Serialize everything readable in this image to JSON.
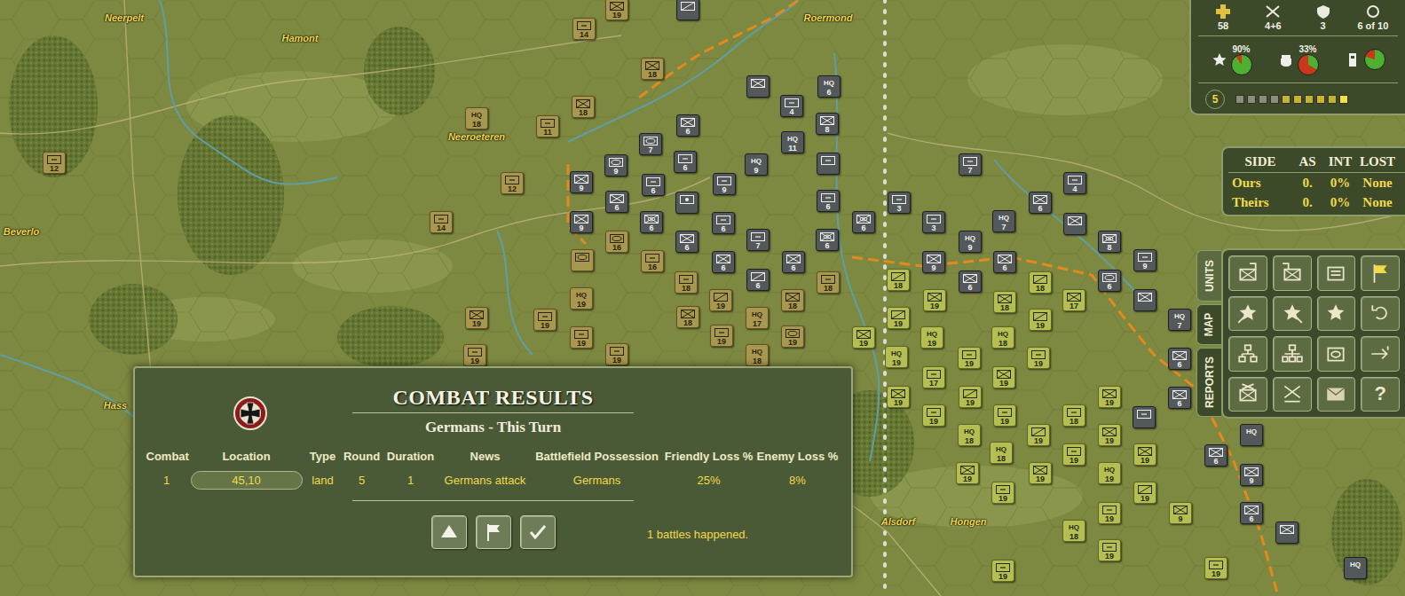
{
  "places": [
    {
      "name": "Neerpelt"
    },
    {
      "name": "Hamont"
    },
    {
      "name": "Neeroeteren"
    },
    {
      "name": "Beverlo"
    },
    {
      "name": "Hass"
    },
    {
      "name": "Alsdorf"
    },
    {
      "name": "Hongen"
    },
    {
      "name": "Roermond"
    }
  ],
  "counters": [
    {
      "side": "british",
      "symbol": "inf",
      "number": "19"
    },
    {
      "side": "german",
      "symbol": "recon"
    },
    {
      "side": "british",
      "symbol": "other",
      "number": "14"
    },
    {
      "side": "british",
      "symbol": "inf",
      "number": "18"
    },
    {
      "side": "british",
      "symbol": "inf",
      "number": "18"
    },
    {
      "side": "british",
      "symbol": "hq",
      "label": "HQ",
      "number": "18"
    },
    {
      "side": "british",
      "symbol": "other",
      "number": "11"
    },
    {
      "side": "british",
      "symbol": "other",
      "number": "12"
    },
    {
      "side": "british",
      "symbol": "other",
      "number": "12"
    },
    {
      "side": "british",
      "symbol": "other",
      "number": "14"
    },
    {
      "side": "british",
      "symbol": "inf",
      "number": "19"
    },
    {
      "side": "british",
      "symbol": "other",
      "number": "19"
    },
    {
      "side": "british",
      "symbol": "armor"
    },
    {
      "side": "british",
      "symbol": "hq",
      "label": "HQ",
      "number": "19"
    },
    {
      "side": "british",
      "symbol": "other",
      "number": "19"
    },
    {
      "side": "british",
      "symbol": "other",
      "number": "19"
    },
    {
      "side": "british",
      "symbol": "other",
      "number": "19"
    },
    {
      "side": "british",
      "symbol": "inf",
      "number": "18"
    },
    {
      "side": "british",
      "symbol": "other",
      "number": "18"
    },
    {
      "side": "british",
      "symbol": "recon",
      "number": "19"
    },
    {
      "side": "british",
      "symbol": "hq",
      "label": "HQ",
      "number": "17"
    },
    {
      "side": "british",
      "symbol": "other",
      "number": "19"
    },
    {
      "side": "british",
      "symbol": "hq",
      "label": "HQ",
      "number": "18"
    },
    {
      "side": "british",
      "symbol": "armor",
      "number": "19"
    },
    {
      "side": "british",
      "symbol": "inf",
      "number": "18"
    },
    {
      "side": "british",
      "symbol": "other",
      "number": "18"
    },
    {
      "side": "british",
      "symbol": "other",
      "number": "16"
    },
    {
      "side": "british",
      "symbol": "armor",
      "number": "16"
    },
    {
      "side": "german",
      "symbol": "inf"
    },
    {
      "side": "german",
      "symbol": "hq",
      "label": "HQ",
      "number": "6"
    },
    {
      "side": "german",
      "symbol": "other",
      "number": "4"
    },
    {
      "side": "german",
      "symbol": "inf",
      "number": "8"
    },
    {
      "side": "german",
      "symbol": "inf",
      "number": "6"
    },
    {
      "side": "german",
      "symbol": "armor",
      "number": "7"
    },
    {
      "side": "german",
      "symbol": "hq",
      "label": "HQ",
      "number": "11"
    },
    {
      "side": "german",
      "symbol": "other",
      "number": "6"
    },
    {
      "side": "german",
      "symbol": "hq",
      "label": "HQ",
      "number": "9"
    },
    {
      "side": "german",
      "symbol": "other"
    },
    {
      "side": "german",
      "symbol": "armor",
      "number": "9"
    },
    {
      "side": "german",
      "symbol": "inf",
      "number": "9"
    },
    {
      "side": "german",
      "symbol": "other",
      "number": "6"
    },
    {
      "side": "german",
      "symbol": "other",
      "number": "9"
    },
    {
      "side": "german",
      "symbol": "art"
    },
    {
      "side": "german",
      "symbol": "other",
      "number": "6"
    },
    {
      "side": "german",
      "symbol": "inf",
      "number": "6"
    },
    {
      "side": "german",
      "symbol": "inf",
      "number": "9"
    },
    {
      "side": "german",
      "symbol": "mech",
      "number": "6"
    },
    {
      "side": "german",
      "symbol": "inf",
      "number": "6"
    },
    {
      "side": "german",
      "symbol": "other",
      "number": "6"
    },
    {
      "side": "german",
      "symbol": "other",
      "number": "7"
    },
    {
      "side": "german",
      "symbol": "mech",
      "number": "6"
    },
    {
      "side": "german",
      "symbol": "inf",
      "number": "6"
    },
    {
      "side": "german",
      "symbol": "recon",
      "number": "6"
    },
    {
      "side": "german",
      "symbol": "inf",
      "number": "6"
    },
    {
      "side": "german",
      "symbol": "mech",
      "number": "6"
    },
    {
      "side": "german",
      "symbol": "other",
      "number": "3"
    },
    {
      "side": "german",
      "symbol": "other",
      "number": "3"
    },
    {
      "side": "german",
      "symbol": "other",
      "number": "7"
    },
    {
      "side": "german",
      "symbol": "inf",
      "number": "6"
    },
    {
      "side": "german",
      "symbol": "other",
      "number": "4"
    },
    {
      "side": "german",
      "symbol": "inf"
    },
    {
      "side": "german",
      "symbol": "hq",
      "label": "HQ",
      "number": "9"
    },
    {
      "side": "german",
      "symbol": "hq",
      "label": "HQ",
      "number": "7"
    },
    {
      "side": "german",
      "symbol": "mech",
      "number": "8"
    },
    {
      "side": "german",
      "symbol": "inf",
      "number": "9"
    },
    {
      "side": "german",
      "symbol": "inf",
      "number": "6"
    },
    {
      "side": "german",
      "symbol": "inf",
      "number": "6"
    },
    {
      "side": "german",
      "symbol": "other",
      "number": "9"
    },
    {
      "side": "german",
      "symbol": "inf"
    },
    {
      "side": "german",
      "symbol": "armor",
      "number": "6"
    },
    {
      "side": "german",
      "symbol": "hq",
      "label": "HQ",
      "number": "7"
    },
    {
      "side": "german",
      "symbol": "inf",
      "number": "6"
    },
    {
      "side": "german",
      "symbol": "inf",
      "number": "6"
    },
    {
      "side": "german",
      "symbol": "other"
    },
    {
      "side": "german",
      "symbol": "inf",
      "number": "6"
    },
    {
      "side": "german",
      "symbol": "hq",
      "label": "HQ"
    },
    {
      "side": "german",
      "symbol": "inf",
      "number": "9"
    },
    {
      "side": "german",
      "symbol": "inf",
      "number": "6"
    },
    {
      "side": "german",
      "symbol": "inf"
    },
    {
      "side": "german",
      "symbol": "hq",
      "label": "HQ"
    },
    {
      "side": "us",
      "symbol": "inf",
      "number": "19"
    },
    {
      "side": "us",
      "symbol": "recon",
      "number": "18"
    },
    {
      "side": "us",
      "symbol": "inf",
      "number": "19"
    },
    {
      "side": "us",
      "symbol": "recon",
      "number": "19"
    },
    {
      "side": "us",
      "symbol": "hq",
      "label": "HQ",
      "number": "19"
    },
    {
      "side": "us",
      "symbol": "hq",
      "label": "HQ",
      "number": "19"
    },
    {
      "side": "us",
      "symbol": "other",
      "number": "19"
    },
    {
      "side": "us",
      "symbol": "hq",
      "label": "HQ",
      "number": "18"
    },
    {
      "side": "us",
      "symbol": "inf",
      "number": "18"
    },
    {
      "side": "us",
      "symbol": "recon",
      "number": "18"
    },
    {
      "side": "us",
      "symbol": "recon",
      "number": "19"
    },
    {
      "side": "us",
      "symbol": "inf",
      "number": "17"
    },
    {
      "side": "us",
      "symbol": "other",
      "number": "19"
    },
    {
      "side": "us",
      "symbol": "other",
      "number": "17"
    },
    {
      "side": "us",
      "symbol": "inf",
      "number": "19"
    },
    {
      "side": "us",
      "symbol": "recon",
      "number": "19"
    },
    {
      "side": "us",
      "symbol": "inf",
      "number": "19"
    },
    {
      "side": "us",
      "symbol": "other",
      "number": "19"
    },
    {
      "side": "us",
      "symbol": "other",
      "number": "19"
    },
    {
      "side": "us",
      "symbol": "hq",
      "label": "HQ",
      "number": "18"
    },
    {
      "side": "us",
      "symbol": "recon",
      "number": "19"
    },
    {
      "side": "us",
      "symbol": "other",
      "number": "18"
    },
    {
      "side": "us",
      "symbol": "inf",
      "number": "19"
    },
    {
      "side": "us",
      "symbol": "inf",
      "number": "19"
    },
    {
      "side": "us",
      "symbol": "inf",
      "number": "19"
    },
    {
      "side": "us",
      "symbol": "hq",
      "label": "HQ",
      "number": "19"
    },
    {
      "side": "us",
      "symbol": "other",
      "number": "19"
    },
    {
      "side": "us",
      "symbol": "inf",
      "number": "19"
    },
    {
      "side": "us",
      "symbol": "hq",
      "label": "HQ",
      "number": "18"
    },
    {
      "side": "us",
      "symbol": "inf",
      "number": "19"
    },
    {
      "side": "us",
      "symbol": "other",
      "number": "19"
    },
    {
      "side": "us",
      "symbol": "recon",
      "number": "19"
    },
    {
      "side": "us",
      "symbol": "other",
      "number": "19"
    },
    {
      "side": "us",
      "symbol": "hq",
      "label": "HQ",
      "number": "18"
    },
    {
      "side": "us",
      "symbol": "inf",
      "number": "9"
    },
    {
      "side": "us",
      "symbol": "other",
      "number": "19"
    },
    {
      "side": "us",
      "symbol": "other",
      "number": "19"
    },
    {
      "side": "us",
      "symbol": "other",
      "number": "19"
    }
  ],
  "status": {
    "stats": [
      {
        "value": "58"
      },
      {
        "value": "4+6"
      },
      {
        "value": "3"
      },
      {
        "value": "6 of 10"
      }
    ],
    "meters": [
      {
        "reading": "90%",
        "level": 0.9
      },
      {
        "reading": "33%",
        "level": 0.33
      },
      {
        "level": 0.8
      }
    ],
    "turn": "5",
    "turn_track": {
      "level": 0.6
    }
  },
  "side_table": {
    "columns": [
      "SIDE",
      "AS",
      "INT",
      "LOST"
    ],
    "rows": [
      [
        "Ours",
        "0.",
        "0%",
        "None"
      ],
      [
        "Theirs",
        "0.",
        "0%",
        "None"
      ]
    ]
  },
  "side_tabs": [
    {
      "label": "UNITS",
      "selected": true
    },
    {
      "label": "MAP",
      "selected": false
    },
    {
      "label": "REPORTS",
      "selected": false
    }
  ],
  "help_key": "?",
  "dialog": {
    "title": "COMBAT RESULTS",
    "subtitle": "Germans - This Turn",
    "columns": [
      "Combat",
      "Location",
      "Type",
      "Round",
      "Duration",
      "News",
      "Battlefield Possession",
      "Friendly Loss %",
      "Enemy Loss %"
    ],
    "rows": [
      [
        "1",
        "45,10",
        "land",
        "5",
        "1",
        "Germans attack",
        "Germans",
        "25%",
        "8%"
      ]
    ],
    "footer": "1 battles happened."
  }
}
